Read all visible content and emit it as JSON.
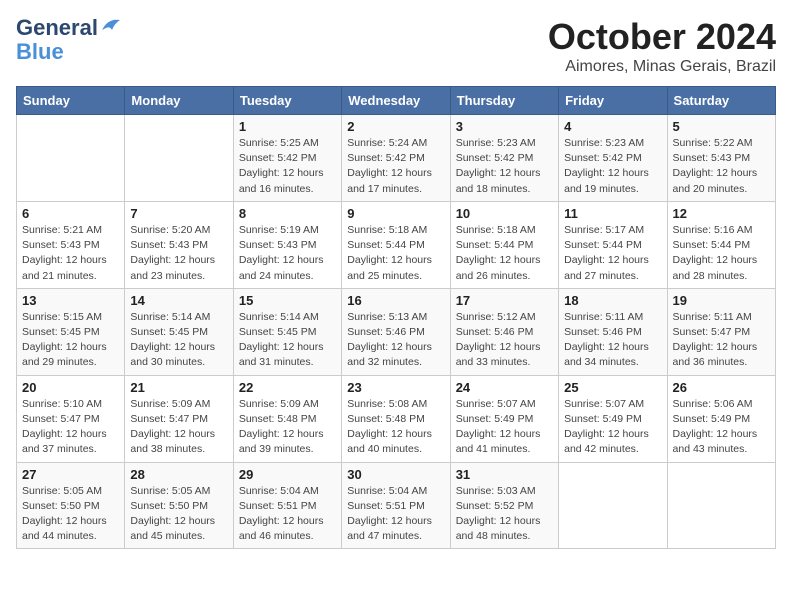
{
  "header": {
    "logo_line1": "General",
    "logo_line2": "Blue",
    "month": "October 2024",
    "location": "Aimores, Minas Gerais, Brazil"
  },
  "weekdays": [
    "Sunday",
    "Monday",
    "Tuesday",
    "Wednesday",
    "Thursday",
    "Friday",
    "Saturday"
  ],
  "weeks": [
    [
      {
        "day": "",
        "info": ""
      },
      {
        "day": "",
        "info": ""
      },
      {
        "day": "1",
        "info": "Sunrise: 5:25 AM\nSunset: 5:42 PM\nDaylight: 12 hours and 16 minutes."
      },
      {
        "day": "2",
        "info": "Sunrise: 5:24 AM\nSunset: 5:42 PM\nDaylight: 12 hours and 17 minutes."
      },
      {
        "day": "3",
        "info": "Sunrise: 5:23 AM\nSunset: 5:42 PM\nDaylight: 12 hours and 18 minutes."
      },
      {
        "day": "4",
        "info": "Sunrise: 5:23 AM\nSunset: 5:42 PM\nDaylight: 12 hours and 19 minutes."
      },
      {
        "day": "5",
        "info": "Sunrise: 5:22 AM\nSunset: 5:43 PM\nDaylight: 12 hours and 20 minutes."
      }
    ],
    [
      {
        "day": "6",
        "info": "Sunrise: 5:21 AM\nSunset: 5:43 PM\nDaylight: 12 hours and 21 minutes."
      },
      {
        "day": "7",
        "info": "Sunrise: 5:20 AM\nSunset: 5:43 PM\nDaylight: 12 hours and 23 minutes."
      },
      {
        "day": "8",
        "info": "Sunrise: 5:19 AM\nSunset: 5:43 PM\nDaylight: 12 hours and 24 minutes."
      },
      {
        "day": "9",
        "info": "Sunrise: 5:18 AM\nSunset: 5:44 PM\nDaylight: 12 hours and 25 minutes."
      },
      {
        "day": "10",
        "info": "Sunrise: 5:18 AM\nSunset: 5:44 PM\nDaylight: 12 hours and 26 minutes."
      },
      {
        "day": "11",
        "info": "Sunrise: 5:17 AM\nSunset: 5:44 PM\nDaylight: 12 hours and 27 minutes."
      },
      {
        "day": "12",
        "info": "Sunrise: 5:16 AM\nSunset: 5:44 PM\nDaylight: 12 hours and 28 minutes."
      }
    ],
    [
      {
        "day": "13",
        "info": "Sunrise: 5:15 AM\nSunset: 5:45 PM\nDaylight: 12 hours and 29 minutes."
      },
      {
        "day": "14",
        "info": "Sunrise: 5:14 AM\nSunset: 5:45 PM\nDaylight: 12 hours and 30 minutes."
      },
      {
        "day": "15",
        "info": "Sunrise: 5:14 AM\nSunset: 5:45 PM\nDaylight: 12 hours and 31 minutes."
      },
      {
        "day": "16",
        "info": "Sunrise: 5:13 AM\nSunset: 5:46 PM\nDaylight: 12 hours and 32 minutes."
      },
      {
        "day": "17",
        "info": "Sunrise: 5:12 AM\nSunset: 5:46 PM\nDaylight: 12 hours and 33 minutes."
      },
      {
        "day": "18",
        "info": "Sunrise: 5:11 AM\nSunset: 5:46 PM\nDaylight: 12 hours and 34 minutes."
      },
      {
        "day": "19",
        "info": "Sunrise: 5:11 AM\nSunset: 5:47 PM\nDaylight: 12 hours and 36 minutes."
      }
    ],
    [
      {
        "day": "20",
        "info": "Sunrise: 5:10 AM\nSunset: 5:47 PM\nDaylight: 12 hours and 37 minutes."
      },
      {
        "day": "21",
        "info": "Sunrise: 5:09 AM\nSunset: 5:47 PM\nDaylight: 12 hours and 38 minutes."
      },
      {
        "day": "22",
        "info": "Sunrise: 5:09 AM\nSunset: 5:48 PM\nDaylight: 12 hours and 39 minutes."
      },
      {
        "day": "23",
        "info": "Sunrise: 5:08 AM\nSunset: 5:48 PM\nDaylight: 12 hours and 40 minutes."
      },
      {
        "day": "24",
        "info": "Sunrise: 5:07 AM\nSunset: 5:49 PM\nDaylight: 12 hours and 41 minutes."
      },
      {
        "day": "25",
        "info": "Sunrise: 5:07 AM\nSunset: 5:49 PM\nDaylight: 12 hours and 42 minutes."
      },
      {
        "day": "26",
        "info": "Sunrise: 5:06 AM\nSunset: 5:49 PM\nDaylight: 12 hours and 43 minutes."
      }
    ],
    [
      {
        "day": "27",
        "info": "Sunrise: 5:05 AM\nSunset: 5:50 PM\nDaylight: 12 hours and 44 minutes."
      },
      {
        "day": "28",
        "info": "Sunrise: 5:05 AM\nSunset: 5:50 PM\nDaylight: 12 hours and 45 minutes."
      },
      {
        "day": "29",
        "info": "Sunrise: 5:04 AM\nSunset: 5:51 PM\nDaylight: 12 hours and 46 minutes."
      },
      {
        "day": "30",
        "info": "Sunrise: 5:04 AM\nSunset: 5:51 PM\nDaylight: 12 hours and 47 minutes."
      },
      {
        "day": "31",
        "info": "Sunrise: 5:03 AM\nSunset: 5:52 PM\nDaylight: 12 hours and 48 minutes."
      },
      {
        "day": "",
        "info": ""
      },
      {
        "day": "",
        "info": ""
      }
    ]
  ]
}
